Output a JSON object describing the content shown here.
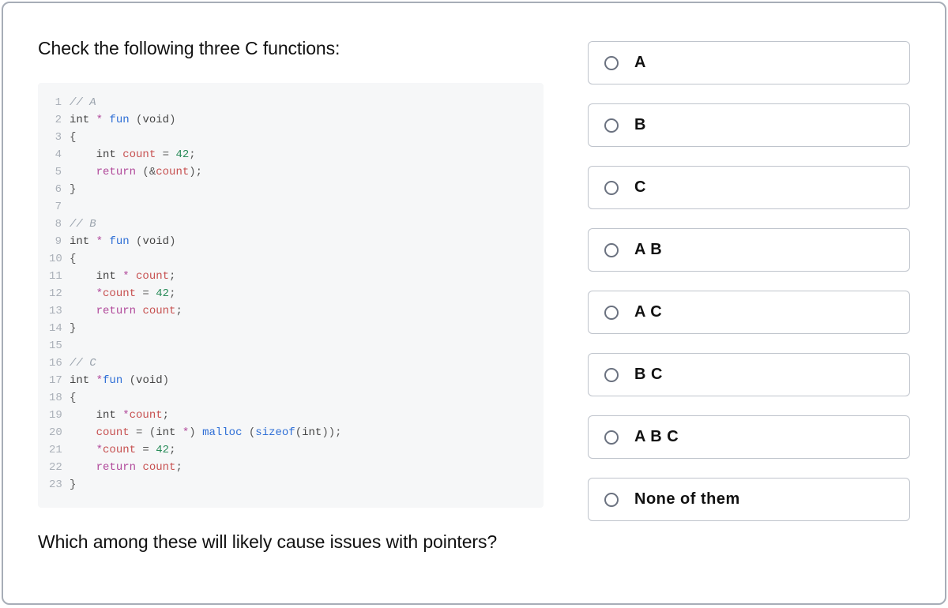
{
  "prompt": "Check the following three C functions:",
  "question": "Which among these will likely cause issues with pointers?",
  "code_lines": [
    {
      "n": 1,
      "seg": [
        {
          "t": "// A",
          "c": "c-comment"
        }
      ]
    },
    {
      "n": 2,
      "seg": [
        {
          "t": "int ",
          "c": "c-type"
        },
        {
          "t": "* ",
          "c": "c-ptr"
        },
        {
          "t": "fun",
          "c": "c-func"
        },
        {
          "t": " (",
          "c": "c-paren"
        },
        {
          "t": "void",
          "c": "c-type"
        },
        {
          "t": ")",
          "c": "c-paren"
        }
      ]
    },
    {
      "n": 3,
      "seg": [
        {
          "t": "{",
          "c": "c-punc"
        }
      ]
    },
    {
      "n": 4,
      "seg": [
        {
          "t": "    ",
          "c": ""
        },
        {
          "t": "int ",
          "c": "c-type"
        },
        {
          "t": "count",
          "c": "c-var"
        },
        {
          "t": " = ",
          "c": "c-punc"
        },
        {
          "t": "42",
          "c": "c-num"
        },
        {
          "t": ";",
          "c": "c-punc"
        }
      ]
    },
    {
      "n": 5,
      "seg": [
        {
          "t": "    ",
          "c": ""
        },
        {
          "t": "return",
          "c": "c-kw"
        },
        {
          "t": " (",
          "c": "c-paren"
        },
        {
          "t": "&",
          "c": "c-punc"
        },
        {
          "t": "count",
          "c": "c-var"
        },
        {
          "t": ");",
          "c": "c-paren"
        }
      ]
    },
    {
      "n": 6,
      "seg": [
        {
          "t": "}",
          "c": "c-punc"
        }
      ]
    },
    {
      "n": 7,
      "seg": [
        {
          "t": "",
          "c": ""
        }
      ]
    },
    {
      "n": 8,
      "seg": [
        {
          "t": "// B",
          "c": "c-comment"
        }
      ]
    },
    {
      "n": 9,
      "seg": [
        {
          "t": "int ",
          "c": "c-type"
        },
        {
          "t": "* ",
          "c": "c-ptr"
        },
        {
          "t": "fun",
          "c": "c-func"
        },
        {
          "t": " (",
          "c": "c-paren"
        },
        {
          "t": "void",
          "c": "c-type"
        },
        {
          "t": ")",
          "c": "c-paren"
        }
      ]
    },
    {
      "n": 10,
      "seg": [
        {
          "t": "{",
          "c": "c-punc"
        }
      ]
    },
    {
      "n": 11,
      "seg": [
        {
          "t": "    ",
          "c": ""
        },
        {
          "t": "int ",
          "c": "c-type"
        },
        {
          "t": "* ",
          "c": "c-ptr"
        },
        {
          "t": "count",
          "c": "c-var"
        },
        {
          "t": ";",
          "c": "c-punc"
        }
      ]
    },
    {
      "n": 12,
      "seg": [
        {
          "t": "    ",
          "c": ""
        },
        {
          "t": "*",
          "c": "c-ptr"
        },
        {
          "t": "count",
          "c": "c-var"
        },
        {
          "t": " = ",
          "c": "c-punc"
        },
        {
          "t": "42",
          "c": "c-num"
        },
        {
          "t": ";",
          "c": "c-punc"
        }
      ]
    },
    {
      "n": 13,
      "seg": [
        {
          "t": "    ",
          "c": ""
        },
        {
          "t": "return",
          "c": "c-kw"
        },
        {
          "t": " ",
          "c": ""
        },
        {
          "t": "count",
          "c": "c-var"
        },
        {
          "t": ";",
          "c": "c-punc"
        }
      ]
    },
    {
      "n": 14,
      "seg": [
        {
          "t": "}",
          "c": "c-punc"
        }
      ]
    },
    {
      "n": 15,
      "seg": [
        {
          "t": "",
          "c": ""
        }
      ]
    },
    {
      "n": 16,
      "seg": [
        {
          "t": "// C",
          "c": "c-comment"
        }
      ]
    },
    {
      "n": 17,
      "seg": [
        {
          "t": "int ",
          "c": "c-type"
        },
        {
          "t": "*",
          "c": "c-ptr"
        },
        {
          "t": "fun",
          "c": "c-func"
        },
        {
          "t": " (",
          "c": "c-paren"
        },
        {
          "t": "void",
          "c": "c-type"
        },
        {
          "t": ")",
          "c": "c-paren"
        }
      ]
    },
    {
      "n": 18,
      "seg": [
        {
          "t": "{",
          "c": "c-punc"
        }
      ]
    },
    {
      "n": 19,
      "seg": [
        {
          "t": "    ",
          "c": ""
        },
        {
          "t": "int ",
          "c": "c-type"
        },
        {
          "t": "*",
          "c": "c-ptr"
        },
        {
          "t": "count",
          "c": "c-var"
        },
        {
          "t": ";",
          "c": "c-punc"
        }
      ]
    },
    {
      "n": 20,
      "seg": [
        {
          "t": "    ",
          "c": ""
        },
        {
          "t": "count",
          "c": "c-var"
        },
        {
          "t": " = (",
          "c": "c-paren"
        },
        {
          "t": "int ",
          "c": "c-type"
        },
        {
          "t": "*",
          "c": "c-ptr"
        },
        {
          "t": ") ",
          "c": "c-paren"
        },
        {
          "t": "malloc",
          "c": "c-cast"
        },
        {
          "t": " (",
          "c": "c-paren"
        },
        {
          "t": "sizeof",
          "c": "c-cast"
        },
        {
          "t": "(",
          "c": "c-paren"
        },
        {
          "t": "int",
          "c": "c-type"
        },
        {
          "t": "));",
          "c": "c-paren"
        }
      ]
    },
    {
      "n": 21,
      "seg": [
        {
          "t": "    ",
          "c": ""
        },
        {
          "t": "*",
          "c": "c-ptr"
        },
        {
          "t": "count",
          "c": "c-var"
        },
        {
          "t": " = ",
          "c": "c-punc"
        },
        {
          "t": "42",
          "c": "c-num"
        },
        {
          "t": ";",
          "c": "c-punc"
        }
      ]
    },
    {
      "n": 22,
      "seg": [
        {
          "t": "    ",
          "c": ""
        },
        {
          "t": "return",
          "c": "c-kw"
        },
        {
          "t": " ",
          "c": ""
        },
        {
          "t": "count",
          "c": "c-var"
        },
        {
          "t": ";",
          "c": "c-punc"
        }
      ]
    },
    {
      "n": 23,
      "seg": [
        {
          "t": "}",
          "c": "c-punc"
        }
      ]
    }
  ],
  "options": [
    {
      "id": "a",
      "label": "A"
    },
    {
      "id": "b",
      "label": "B"
    },
    {
      "id": "c",
      "label": "C"
    },
    {
      "id": "ab",
      "label": "A B"
    },
    {
      "id": "ac",
      "label": "A C"
    },
    {
      "id": "bc",
      "label": "B C"
    },
    {
      "id": "abc",
      "label": "A B C"
    },
    {
      "id": "none",
      "label": "None of them"
    }
  ]
}
